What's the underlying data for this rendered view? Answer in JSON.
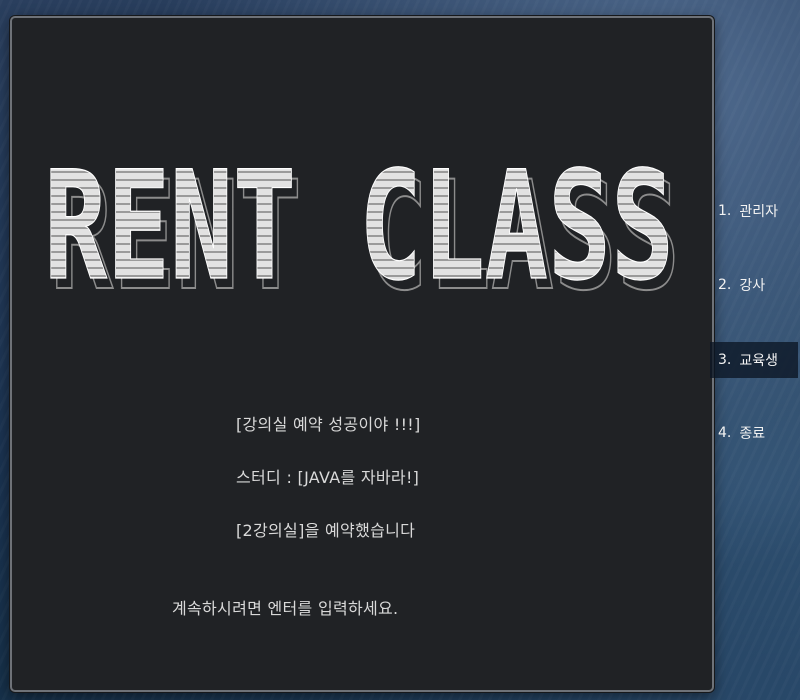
{
  "logo": {
    "text": "RENT CLASS"
  },
  "console": {
    "success_line": "[강의실 예약 성공이야 !!!]",
    "study_line": "스터디 : [JAVA를 자바라!]",
    "room_line": "[2강의실]을 예약했습니다",
    "continue_prompt": "계속하시려면 엔터를 입력하세요."
  },
  "menu": {
    "items": [
      {
        "num": "1.",
        "label": "관리자"
      },
      {
        "num": "2.",
        "label": "강사"
      },
      {
        "num": "3.",
        "label": "교육생"
      },
      {
        "num": "4.",
        "label": "종료"
      }
    ],
    "active_index": 2
  }
}
